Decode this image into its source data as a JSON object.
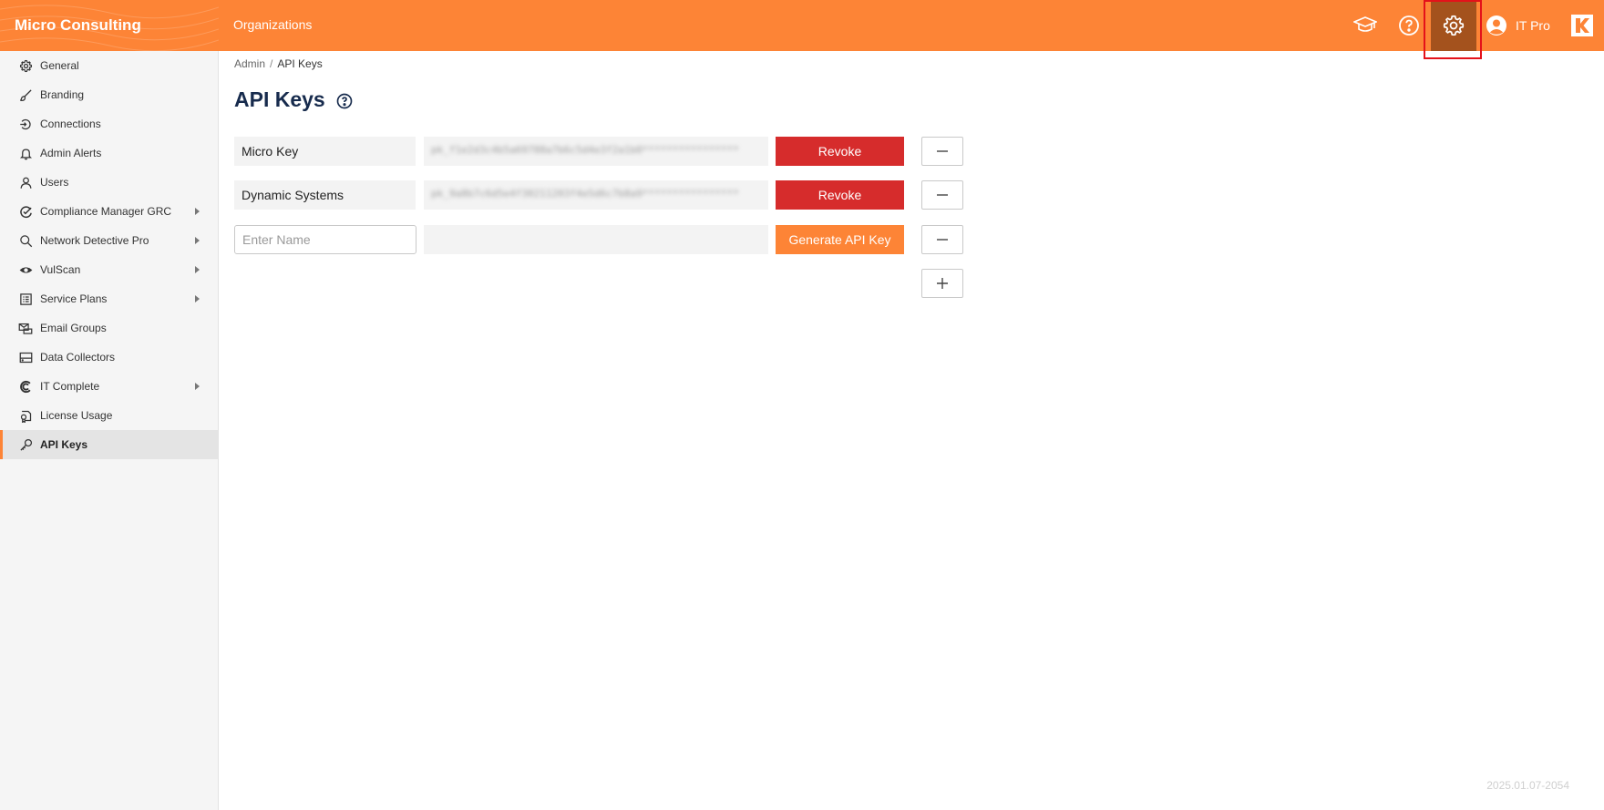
{
  "header": {
    "brand": "Micro Consulting",
    "nav_organizations": "Organizations",
    "user_name": "IT Pro",
    "colors": {
      "primary": "#fd8436",
      "active": "#a4521d",
      "highlight": "#e4121a"
    },
    "icons": [
      "graduation-cap-icon",
      "help-circle-icon",
      "gear-icon",
      "user-circle-icon",
      "k-logo-icon"
    ]
  },
  "sidebar": {
    "items": [
      {
        "label": "General",
        "icon": "gear-icon",
        "has_submenu": false
      },
      {
        "label": "Branding",
        "icon": "brush-icon",
        "has_submenu": false
      },
      {
        "label": "Connections",
        "icon": "plug-icon",
        "has_submenu": false
      },
      {
        "label": "Admin Alerts",
        "icon": "bell-icon",
        "has_submenu": false
      },
      {
        "label": "Users",
        "icon": "user-icon",
        "has_submenu": false
      },
      {
        "label": "Compliance Manager GRC",
        "icon": "compliance-icon",
        "has_submenu": true
      },
      {
        "label": "Network Detective Pro",
        "icon": "search-icon",
        "has_submenu": true
      },
      {
        "label": "VulScan",
        "icon": "eye-icon",
        "has_submenu": true
      },
      {
        "label": "Service Plans",
        "icon": "list-icon",
        "has_submenu": true
      },
      {
        "label": "Email Groups",
        "icon": "email-group-icon",
        "has_submenu": false
      },
      {
        "label": "Data Collectors",
        "icon": "drive-icon",
        "has_submenu": false
      },
      {
        "label": "IT Complete",
        "icon": "it-complete-icon",
        "has_submenu": true
      },
      {
        "label": "License Usage",
        "icon": "license-icon",
        "has_submenu": false
      },
      {
        "label": "API Keys",
        "icon": "key-icon",
        "has_submenu": false,
        "active": true
      }
    ]
  },
  "breadcrumb": {
    "parent": "Admin",
    "separator": "/",
    "current": "API Keys"
  },
  "page": {
    "title": "API Keys"
  },
  "api_keys": [
    {
      "name": "Micro Key",
      "key_masked": "pk_f1e2d3c4b5a69788a7b6c5d4e3f2a1b0****************",
      "action": "Revoke"
    },
    {
      "name": "Dynamic Systems",
      "key_masked": "pk_9a8b7c6d5e4f30211203f4e5d6c7b8a9****************",
      "action": "Revoke"
    }
  ],
  "new_key": {
    "placeholder": "Enter Name",
    "value": "",
    "action": "Generate API Key"
  },
  "footer": {
    "version": "2025.01.07-2054"
  }
}
